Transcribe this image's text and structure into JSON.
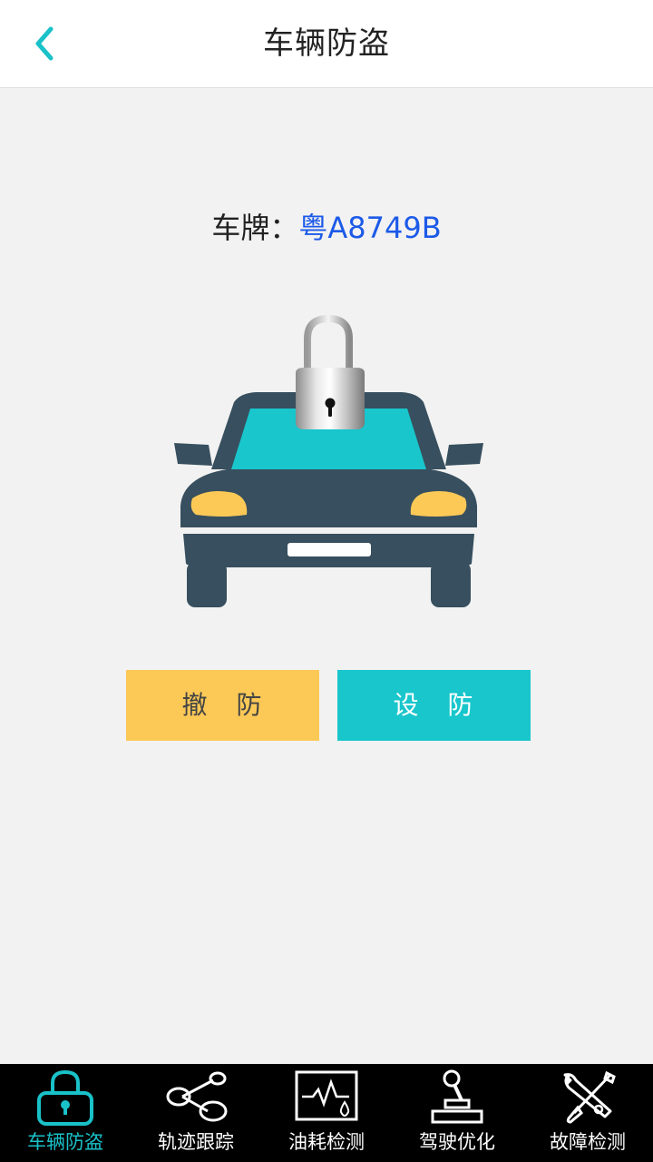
{
  "header": {
    "title": "车辆防盗"
  },
  "plate": {
    "label": "车牌：",
    "value": "粤A8749B"
  },
  "actions": {
    "disarm": "撤　防",
    "arm": "设　防"
  },
  "tabs": [
    {
      "label": "车辆防盗",
      "icon": "lock-icon",
      "active": true
    },
    {
      "label": "轨迹跟踪",
      "icon": "share-nodes-icon",
      "active": false
    },
    {
      "label": "油耗检测",
      "icon": "fuel-monitor-icon",
      "active": false
    },
    {
      "label": "驾驶优化",
      "icon": "gear-shift-icon",
      "active": false
    },
    {
      "label": "故障检测",
      "icon": "tools-icon",
      "active": false
    }
  ],
  "colors": {
    "accent": "#19c1c8",
    "plate_value": "#1c5ae8",
    "disarm_button": "#fcc957",
    "arm_button": "#18c6cc",
    "car_body": "#374f5e",
    "headlight": "#fcc957",
    "tabbar": "#000000"
  }
}
